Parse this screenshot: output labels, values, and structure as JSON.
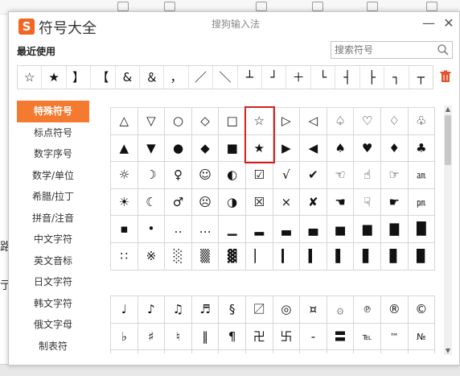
{
  "window": {
    "title": "符号大全",
    "ime_name": "搜狗输入法",
    "logo_glyph": "S",
    "logo_color": "#f26522",
    "minimize_glyph": "—",
    "close_glyph": "✕"
  },
  "background": {
    "left_chars": [
      "路",
      "亍"
    ]
  },
  "recent": {
    "label": "最近使用",
    "symbols": [
      "☆",
      "★",
      "】",
      "【",
      "&",
      "＆",
      "，",
      "／",
      "＼",
      "┴",
      "┘",
      "＋",
      "└",
      "┤",
      "├",
      "┐",
      "┬"
    ]
  },
  "search": {
    "placeholder": "搜索符号"
  },
  "sidebar": {
    "items": [
      {
        "label": "特殊符号",
        "active": true
      },
      {
        "label": "标点符号",
        "active": false
      },
      {
        "label": "数字序号",
        "active": false
      },
      {
        "label": "数学/单位",
        "active": false
      },
      {
        "label": "希腊/拉丁",
        "active": false
      },
      {
        "label": "拼音/注音",
        "active": false
      },
      {
        "label": "中文字符",
        "active": false
      },
      {
        "label": "英文音标",
        "active": false
      },
      {
        "label": "日文字符",
        "active": false
      },
      {
        "label": "韩文字符",
        "active": false
      },
      {
        "label": "俄文字母",
        "active": false
      },
      {
        "label": "制表符",
        "active": false
      }
    ],
    "active_color": "#f47a30"
  },
  "grid1": [
    [
      "△",
      "▽",
      "○",
      "◇",
      "□",
      "☆",
      "▷",
      "◁",
      "♤",
      "♡",
      "♢",
      "♧"
    ],
    [
      "▲",
      "▼",
      "●",
      "◆",
      "■",
      "★",
      "▶",
      "◀",
      "♠",
      "♥",
      "♦",
      "♣"
    ],
    [
      "☼",
      "☽",
      "♀",
      "☺",
      "◐",
      "☑",
      "√",
      "✔",
      "☜",
      "☝",
      "☞",
      "㏂"
    ],
    [
      "☀",
      "☾",
      "♂",
      "☹",
      "◑",
      "☒",
      "×",
      "✘",
      "☚",
      "☟",
      "☛",
      "㏘"
    ],
    [
      "▪",
      "•",
      "‥",
      "…",
      "▁",
      "▂",
      "▃",
      "▄",
      "▅",
      "▆",
      "▇",
      "█"
    ],
    [
      "∷",
      "※",
      "░",
      "▒",
      "▓",
      "▏",
      "▎",
      "▍",
      "▌",
      "▋",
      "▊",
      "▉"
    ]
  ],
  "grid2": [
    [
      "♩",
      "♪",
      "♫",
      "♬",
      "§",
      "〼",
      "◎",
      "¤",
      "۞",
      "℗",
      "®",
      "©"
    ],
    [
      "♭",
      "♯",
      "♮",
      "‖",
      "¶",
      "卍",
      "卐",
      "‐",
      "〓",
      "℡",
      "™",
      "№"
    ],
    [
      "",
      "",
      "",
      "",
      "",
      "",
      "",
      "",
      "",
      "",
      "",
      ""
    ]
  ],
  "highlight_color": "#d42020"
}
